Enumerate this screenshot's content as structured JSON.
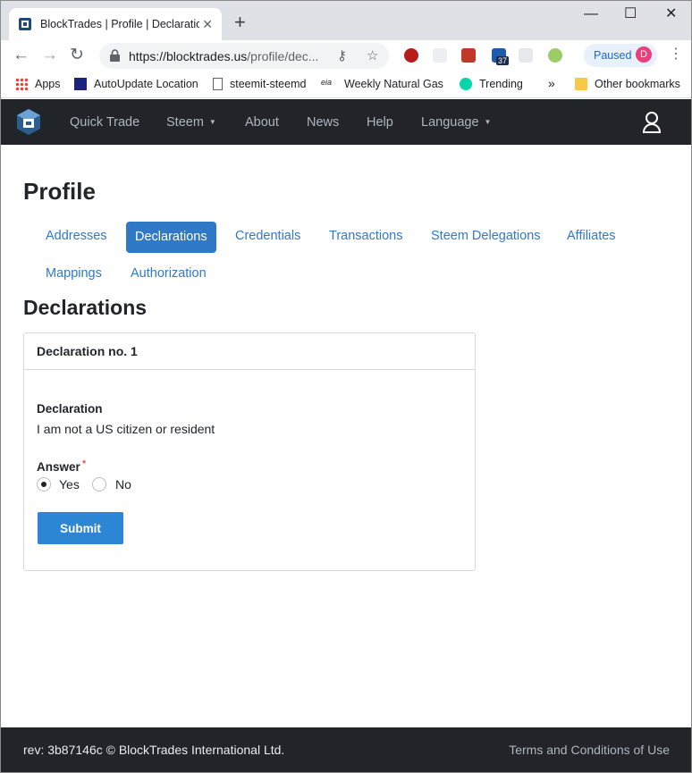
{
  "browser": {
    "tab_title": "BlockTrades | Profile | Declarations",
    "url_host": "https://blocktrades.us",
    "url_path": "/profile/dec...",
    "paused_label": "Paused",
    "profile_initial": "D",
    "extension_badge": "37",
    "bookmarks": [
      "Apps",
      "AutoUpdate Location",
      "steemit-steemd",
      "Weekly Natural Gas S",
      "Trending",
      "Other bookmarks"
    ],
    "overflow": "»"
  },
  "nav": {
    "items": [
      "Quick Trade",
      "Steem",
      "About",
      "News",
      "Help",
      "Language"
    ]
  },
  "page": {
    "title": "Profile",
    "tabs": [
      "Addresses",
      "Declarations",
      "Credentials",
      "Transactions",
      "Steem Delegations",
      "Affiliates",
      "Mappings",
      "Authorization"
    ],
    "active_tab": "Declarations",
    "section_title": "Declarations"
  },
  "declaration": {
    "header": "Declaration no. 1",
    "label": "Declaration",
    "text": "I am not a US citizen or resident",
    "answer_label": "Answer",
    "required_mark": "*",
    "options": [
      "Yes",
      "No"
    ],
    "selected": "Yes",
    "submit_label": "Submit"
  },
  "footer": {
    "rev": "rev: 3b87146c © BlockTrades International Ltd.",
    "terms": "Terms and Conditions of Use"
  },
  "colors": {
    "navbar": "#212529",
    "accent": "#2f79c6",
    "button": "#2c86d4",
    "link": "#3378c4"
  }
}
